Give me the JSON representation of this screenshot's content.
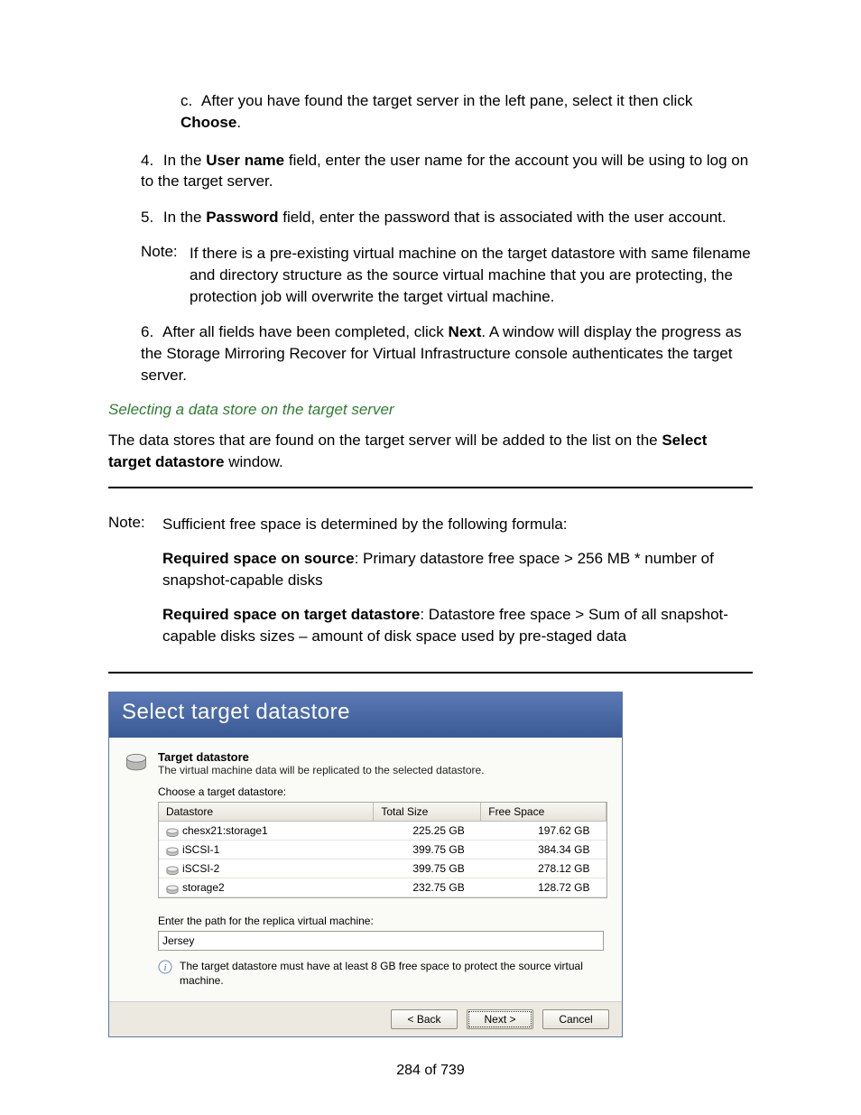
{
  "steps": {
    "c": {
      "marker": "c.",
      "prefix": "After you have found the target server in the left pane, select it then click ",
      "bold": "Choose",
      "suffix": "."
    },
    "s4": {
      "marker": "4.",
      "t1": "In the ",
      "b1": "User name",
      "t2": " field, enter the user name for the account you will be using to log on to the target server."
    },
    "s5": {
      "marker": "5.",
      "t1": "In the ",
      "b1": "Password",
      "t2": " field, enter the password that is associated with the user account."
    },
    "note1": {
      "label": "Note:",
      "text": "If there is a pre-existing virtual machine on the target datastore with same filename and directory structure as the source virtual machine that you are protecting, the protection job will overwrite the target virtual machine."
    },
    "s6": {
      "marker": "6.",
      "t1": "After all fields have been completed, click ",
      "b1": "Next",
      "t2": ". A window will display the progress as the Storage Mirroring Recover for Virtual Infrastructure console authenticates the target server."
    }
  },
  "heading": "Selecting a data store on the target server",
  "intro": {
    "t1": "The data stores that are found on the target server will be added to the list on the ",
    "b1": "Select target datastore",
    "t2": " window."
  },
  "note_block": {
    "label": "Note:",
    "p1": "Sufficient free space is determined by the following formula:",
    "p2b": "Required space on source",
    "p2t": ": Primary datastore free space > 256 MB * number of snapshot-capable disks",
    "p3b": "Required space on target datastore",
    "p3t": ": Datastore free space > Sum of all snapshot-capable disks sizes – amount of disk space used by pre-staged data"
  },
  "dialog": {
    "title": "Select target datastore",
    "section_title": "Target datastore",
    "section_sub": "The virtual machine data will be replicated to the selected datastore.",
    "choose_label": "Choose a target datastore:",
    "cols": {
      "c0": "Datastore",
      "c1": "Total Size",
      "c2": "Free Space"
    },
    "rows": [
      {
        "name": "chesx21:storage1",
        "total": "225.25 GB",
        "free": "197.62 GB"
      },
      {
        "name": "iSCSI-1",
        "total": "399.75 GB",
        "free": "384.34 GB"
      },
      {
        "name": "iSCSI-2",
        "total": "399.75 GB",
        "free": "278.12 GB"
      },
      {
        "name": "storage2",
        "total": "232.75 GB",
        "free": "128.72 GB"
      }
    ],
    "enter_label": "Enter the path for the replica virtual machine:",
    "path_value": "Jersey",
    "info_text": "The target datastore must have at least 8 GB free space to protect the source virtual machine.",
    "buttons": {
      "back": "< Back",
      "next": "Next >",
      "cancel": "Cancel"
    }
  },
  "pager": "284 of 739"
}
